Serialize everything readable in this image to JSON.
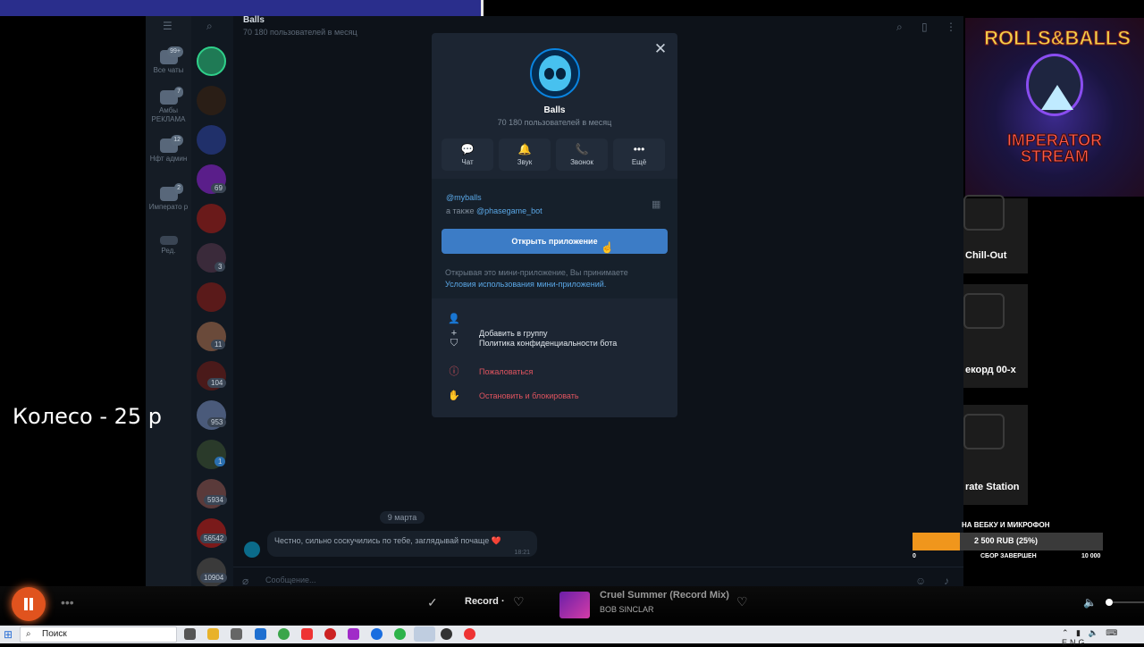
{
  "telegram": {
    "folders": [
      {
        "label": "Все чаты",
        "badge": "99+"
      },
      {
        "label": "Амбы РЕКЛАМА",
        "badge": "7"
      },
      {
        "label": "Нфт админ",
        "badge": "12"
      },
      {
        "label": "Императо р",
        "badge": "2"
      },
      {
        "label": "Ред.",
        "badge": ""
      }
    ],
    "chat_badges": [
      "69",
      "3",
      "11",
      "104",
      "953",
      "1",
      "5934",
      "56542",
      "10904"
    ],
    "chat_header": {
      "title": "Balls",
      "subtitle": "70 180 пользователей в месяц"
    },
    "date_separator": "9 марта",
    "message": {
      "text": "Честно, сильно соскучились по тебе, заглядывай почаще ❤️",
      "time": "18:21"
    },
    "composer_placeholder": "Сообщение..."
  },
  "modal": {
    "title": "Balls",
    "subtitle": "70 180 пользователей в месяц",
    "close_glyph": "✕",
    "actions": [
      {
        "label": "Чат",
        "icon": "💬"
      },
      {
        "label": "Звук",
        "icon": "🔔"
      },
      {
        "label": "Звонок",
        "icon": "📞"
      },
      {
        "label": "Ещё",
        "icon": "•••"
      }
    ],
    "username": "@myballs",
    "also_prefix": "а также ",
    "also_bot": "@phasegame_bot",
    "open_app_label": "Открыть приложение",
    "terms_text": "Открывая это мини-приложение, Вы принимаете",
    "terms_link": "Условия использования мини-приложений.",
    "menu": [
      {
        "label": "Добавить в группу",
        "icon": "👤+"
      },
      {
        "label": "Политика конфиденциальности бота",
        "icon": "⛉"
      },
      {
        "label": "Пожаловаться",
        "icon": "ⓘ"
      },
      {
        "label": "Остановить и блокировать",
        "icon": "✋"
      }
    ]
  },
  "overlay": {
    "wheel_text": "Колесо - 25 р",
    "logo_title": "ROLLS&BALLS",
    "logo_subtitle_1": "IMPERATOR",
    "logo_subtitle_2": "STREAM",
    "radios": [
      {
        "label": "Chill-Out"
      },
      {
        "label": "екорд 00-х"
      },
      {
        "label": "rate Station"
      }
    ],
    "donation": {
      "title": "НА ВЕБКУ И МИКРОФОН",
      "amount": "2 500 RUB (25%)",
      "progress": 0.25,
      "min": "0",
      "status": "СБОР ЗАВЕРШЕН",
      "max": "10 000"
    }
  },
  "player": {
    "station": "Record ·",
    "track_title": "Cruel Summer (Record Mix)",
    "track_artist": "BOB SINCLAR"
  },
  "taskbar": {
    "search_placeholder": "Поиск",
    "tray_lang": "ENG"
  },
  "colors": {
    "accent": "#3c7cc6",
    "danger": "#e0545f",
    "donation_fill": "#f0961c"
  }
}
